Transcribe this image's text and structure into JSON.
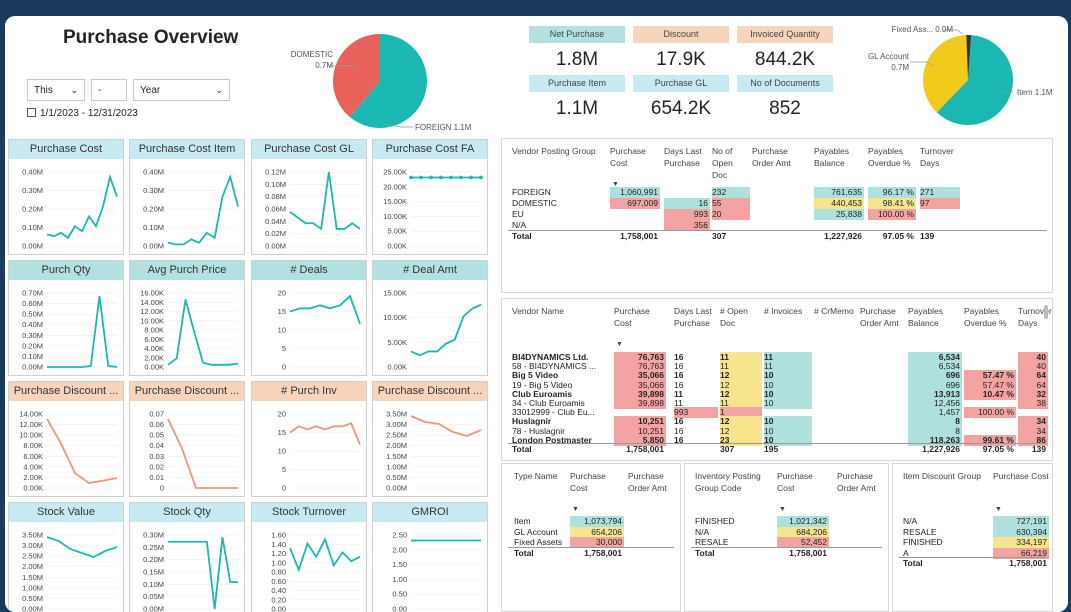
{
  "title": "Purchase Overview",
  "filters": {
    "period": "This",
    "count": "-",
    "unit": "Year",
    "date_range": "1/1/2023 - 12/31/2023"
  },
  "colors": {
    "teal": "#1ab8b0",
    "red": "#e8615a",
    "blue_hdr": "#c7e9f1",
    "orange_hdr": "#f9d4bd",
    "teal_hdr": "#b3e1e1",
    "salmon": "#e59a7b",
    "yellow": "#f2ca1c",
    "green_bar": "#aee0dd",
    "pink_bar": "#f4a3a3",
    "yellow_bar": "#f6e58d"
  },
  "pie1": {
    "domestic_label": "DOMESTIC",
    "domestic_value": "0.7M",
    "foreign_label": "FOREIGN 1.1M",
    "domestic": 0.7,
    "foreign": 1.1
  },
  "pie2": {
    "fixed_label": "Fixed Ass... 0.0M",
    "gl_label": "GL Account",
    "gl_value": "0.7M",
    "item_label": "Item 1.1M",
    "fixed": 0.03,
    "gl": 0.654,
    "item": 1.074
  },
  "kpis": [
    {
      "label": "Net Purchase",
      "value": "1.8M",
      "color": "teal_hdr"
    },
    {
      "label": "Discount",
      "value": "17.9K",
      "color": "orange_hdr"
    },
    {
      "label": "Invoiced Quantity",
      "value": "844.2K",
      "color": "orange_hdr"
    },
    {
      "label": "Purchase Item",
      "value": "1.1M",
      "color": "blue_hdr"
    },
    {
      "label": "Purchase GL",
      "value": "654.2K",
      "color": "blue_hdr"
    },
    {
      "label": "No of Documents",
      "value": "852",
      "color": "blue_hdr"
    }
  ],
  "chart_data": [
    {
      "type": "line",
      "title": "Purchase Cost",
      "color": "#1ab8b0",
      "yticks": [
        "0.40M",
        "0.30M",
        "0.20M",
        "0.10M",
        "0.00M"
      ],
      "ylim": [
        0,
        0.45
      ],
      "values": [
        0.07,
        0.06,
        0.08,
        0.05,
        0.12,
        0.09,
        0.18,
        0.12,
        0.24,
        0.42,
        0.3
      ]
    },
    {
      "type": "line",
      "title": "Purchase Cost Item",
      "color": "#1ab8b0",
      "yticks": [
        "0.40M",
        "0.30M",
        "0.20M",
        "0.10M",
        "0.00M"
      ],
      "ylim": [
        0,
        0.45
      ],
      "values": [
        0.02,
        0.01,
        0.01,
        0.04,
        0.02,
        0.08,
        0.05,
        0.3,
        0.42,
        0.24
      ]
    },
    {
      "type": "line",
      "title": "Purchase Cost GL",
      "color": "#1ab8b0",
      "yticks": [
        "0.12M",
        "0.10M",
        "0.08M",
        "0.06M",
        "0.04M",
        "0.02M",
        "0.00M"
      ],
      "ylim": [
        0,
        0.13
      ],
      "values": [
        0.06,
        0.05,
        0.04,
        0.04,
        0.03,
        0.13,
        0.03,
        0.03,
        0.04,
        0.03
      ]
    },
    {
      "type": "line",
      "title": "Purchase Cost FA",
      "color": "#1ab8b0",
      "yticks": [
        "25.00K",
        "20.00K",
        "15.00K",
        "10.00K",
        "5.00K",
        "0.00K"
      ],
      "ylim": [
        0,
        27
      ],
      "values": [
        25,
        25,
        25,
        25,
        25,
        25,
        25,
        25
      ],
      "marker": true
    },
    {
      "type": "line",
      "title": "Purch Qty",
      "color": "#1ab8b0",
      "yticks": [
        "0.70M",
        "0.60M",
        "0.50M",
        "0.40M",
        "0.30M",
        "0.20M",
        "0.10M",
        "0.00M"
      ],
      "ylim": [
        0,
        0.75
      ],
      "values": [
        0.0,
        0.0,
        0.0,
        0.0,
        0.0,
        0.01,
        0.72,
        0.01,
        0.0
      ]
    },
    {
      "type": "line",
      "title": "Avg Purch Price",
      "color": "#1ab8b0",
      "yticks": [
        "16.00K",
        "14.00K",
        "12.00K",
        "10.00K",
        "8.00K",
        "6.00K",
        "4.00K",
        "2.00K",
        "0.00K"
      ],
      "ylim": [
        0,
        17
      ],
      "values": [
        0.5,
        2,
        15.5,
        8,
        1,
        0.5,
        0.5,
        0.5,
        0.8
      ]
    },
    {
      "type": "line",
      "title": "# Deals",
      "color": "#1ab8b0",
      "yticks": [
        "20",
        "15",
        "10",
        "5",
        "0"
      ],
      "ylim": [
        0,
        24
      ],
      "values": [
        18,
        19,
        19,
        20,
        19,
        20,
        23,
        14
      ]
    },
    {
      "type": "line",
      "title": "# Deal Amt",
      "color": "#1ab8b0",
      "yticks": [
        "15.00K",
        "10.00K",
        "5.00K",
        "0.00K"
      ],
      "ylim": [
        0,
        19
      ],
      "values": [
        4,
        3,
        4,
        4,
        6,
        7,
        13,
        15,
        16
      ]
    },
    {
      "type": "line",
      "title": "Purchase Discount ...",
      "color": "#e59a7b",
      "yticks": [
        "14.00K",
        "12.00K",
        "10.00K",
        "8.00K",
        "6.00K",
        "4.00K",
        "2.00K",
        "0.00K"
      ],
      "ylim": [
        0,
        15
      ],
      "values": [
        14,
        9,
        3,
        1,
        1.5,
        2
      ]
    },
    {
      "type": "line",
      "title": "Purchase Discount ...",
      "color": "#e59a7b",
      "yticks": [
        "0.07",
        "0.06",
        "0.05",
        "0.04",
        "0.03",
        "0.02",
        "0.01",
        "0"
      ],
      "ylim": [
        0,
        0.075
      ],
      "values": [
        0.07,
        0.04,
        0.0,
        0.0,
        0.0,
        0.0
      ]
    },
    {
      "type": "line",
      "title": "# Purch Inv",
      "color": "#e59a7b",
      "yticks": [
        "20",
        "15",
        "10",
        "5",
        "0"
      ],
      "ylim": [
        0,
        24
      ],
      "values": [
        18,
        20,
        19,
        20,
        19,
        20,
        20,
        21,
        14
      ]
    },
    {
      "type": "line",
      "title": "Purchase Discount ...",
      "color": "#e59a7b",
      "yticks": [
        "3.50M",
        "3.00M",
        "2.50M",
        "2.00M",
        "1.50M",
        "1.00M",
        "0.50M",
        "0.00M"
      ],
      "ylim": [
        0,
        3.7
      ],
      "values": [
        3.6,
        3.3,
        3.2,
        2.8,
        2.6,
        2.9
      ]
    },
    {
      "type": "line",
      "title": "Stock Value",
      "color": "#1ab8b0",
      "yticks": [
        "3.50M",
        "3.00M",
        "2.50M",
        "2.00M",
        "1.50M",
        "1.00M",
        "0.50M",
        "0.00M"
      ],
      "ylim": [
        0,
        3.7
      ],
      "values": [
        3.6,
        3.4,
        3.0,
        2.8,
        2.6,
        2.9,
        3.1
      ]
    },
    {
      "type": "line",
      "title": "Stock Qty",
      "color": "#1ab8b0",
      "yticks": [
        "0.30M",
        "0.25M",
        "0.20M",
        "0.15M",
        "0.10M",
        "0.05M",
        "0.00M"
      ],
      "ylim": [
        0,
        0.33
      ],
      "values": [
        0.3,
        0.3,
        0.3,
        0.3,
        0.3,
        0.3,
        0.0,
        0.32,
        0.12,
        0.12
      ]
    },
    {
      "type": "line",
      "title": "Stock Turnover",
      "color": "#1ab8b0",
      "yticks": [
        "1.60",
        "1.40",
        "1.20",
        "1.00",
        "0.80",
        "0.60",
        "0.40",
        "0.20",
        "0.00"
      ],
      "ylim": [
        0,
        1.7
      ],
      "values": [
        1.4,
        0.9,
        1.5,
        1.2,
        1.6,
        1.0,
        1.3,
        1.1,
        1.2
      ]
    },
    {
      "type": "line",
      "title": "GMROI",
      "color": "#1ab8b0",
      "yticks": [
        "2.50",
        "2.00",
        "1.50",
        "1.00",
        "0.50",
        "0.00"
      ],
      "ylim": [
        0,
        2.7
      ],
      "values": [
        2.5,
        2.5,
        2.5,
        2.5,
        2.5,
        2.5,
        2.5
      ]
    }
  ],
  "vpg": {
    "headers": [
      "Vendor Posting Group",
      "Purchase Cost",
      "Days Last Purchase",
      "No of Open Doc",
      "Purchase Order Amt",
      "Payables Balance",
      "Payables Overdue %",
      "Turnover Days"
    ],
    "rows": [
      {
        "name": "FOREIGN",
        "cost": "1,060,991",
        "days": "",
        "open": "232",
        "order": "",
        "bal": "761,635",
        "ovd": "96.17 %",
        "turn": "271"
      },
      {
        "name": "DOMESTIC",
        "cost": "697,009",
        "days": "16",
        "open": "55",
        "order": "",
        "bal": "440,453",
        "ovd": "98.41 %",
        "turn": "97"
      },
      {
        "name": "EU",
        "cost": "",
        "days": "993",
        "open": "20",
        "order": "",
        "bal": "25,838",
        "ovd": "100.00 %",
        "turn": ""
      },
      {
        "name": "N/A",
        "cost": "",
        "days": "356",
        "open": "",
        "order": "",
        "bal": "",
        "ovd": "",
        "turn": ""
      }
    ],
    "total": {
      "name": "Total",
      "cost": "1,758,001",
      "days": "",
      "open": "307",
      "order": "",
      "bal": "1,227,926",
      "ovd": "97.05 %",
      "turn": "139"
    }
  },
  "vendors": {
    "headers": [
      "Vendor Name",
      "Purchase Cost",
      "Days Last Purchase",
      "# Open Doc",
      "# Invoices",
      "# CrMemo",
      "Purchase Order Amt",
      "Payables Balance",
      "Payables Overdue %",
      "Turnover Days"
    ],
    "rows": [
      {
        "name": "BI4DYNAMICS Ltd.",
        "bold": true,
        "cost": "76,763",
        "days": "16",
        "open": "11",
        "inv": "11",
        "bal": "6,534",
        "ovd": "",
        "turn": "40"
      },
      {
        "name": "58 - BI4DYNAMICS ...",
        "bold": false,
        "cost": "76,763",
        "days": "16",
        "open": "11",
        "inv": "11",
        "bal": "6,534",
        "ovd": "",
        "turn": "40"
      },
      {
        "name": "Big 5 Video",
        "bold": true,
        "cost": "35,066",
        "days": "16",
        "open": "12",
        "inv": "10",
        "bal": "696",
        "ovd": "57.47 %",
        "turn": "64"
      },
      {
        "name": "19 - Big 5 Video",
        "bold": false,
        "cost": "35,066",
        "days": "16",
        "open": "12",
        "inv": "10",
        "bal": "696",
        "ovd": "57.47 %",
        "turn": "64"
      },
      {
        "name": "Club Euroamis",
        "bold": true,
        "cost": "39,898",
        "days": "11",
        "open": "12",
        "inv": "10",
        "bal": "13,913",
        "ovd": "10.47 %",
        "turn": "32"
      },
      {
        "name": "34 - Club Euroamis",
        "bold": false,
        "cost": "39,898",
        "days": "11",
        "open": "11",
        "inv": "10",
        "bal": "12,456",
        "ovd": "",
        "turn": "38"
      },
      {
        "name": "33012999 - Club Eu...",
        "bold": false,
        "cost": "",
        "days": "993",
        "open": "1",
        "inv": "",
        "bal": "1,457",
        "ovd": "100.00 %",
        "turn": ""
      },
      {
        "name": "Huslagnir",
        "bold": true,
        "cost": "10,251",
        "days": "16",
        "open": "12",
        "inv": "10",
        "bal": "8",
        "ovd": "",
        "turn": "34"
      },
      {
        "name": "78 - Huslagnir",
        "bold": false,
        "cost": "10,251",
        "days": "16",
        "open": "12",
        "inv": "10",
        "bal": "8",
        "ovd": "",
        "turn": "34"
      },
      {
        "name": "London Postmaster",
        "bold": true,
        "cost": "5,850",
        "days": "16",
        "open": "23",
        "inv": "10",
        "bal": "118,263",
        "ovd": "99.61 %",
        "turn": "86"
      }
    ],
    "total": {
      "name": "Total",
      "cost": "1,758,001",
      "days": "",
      "open": "307",
      "inv": "195",
      "bal": "1,227,926",
      "ovd": "97.05 %",
      "turn": "139"
    }
  },
  "types": {
    "headers": [
      "Type Name",
      "Purchase Cost",
      "Purchase Order Amt"
    ],
    "rows": [
      {
        "name": "Item",
        "cost": "1,073,794"
      },
      {
        "name": "GL Account",
        "cost": "654,206"
      },
      {
        "name": "Fixed Assets",
        "cost": "30,000"
      }
    ],
    "total": {
      "name": "Total",
      "cost": "1,758,001"
    }
  },
  "inv_posting": {
    "headers": [
      "Inventory Posting Group Code",
      "Purchase Cost",
      "Purchase Order Amt"
    ],
    "rows": [
      {
        "name": "FINISHED",
        "cost": "1,021,342"
      },
      {
        "name": "N/A",
        "cost": "684,206"
      },
      {
        "name": "RESALE",
        "cost": "52,452"
      }
    ],
    "total": {
      "name": "Total",
      "cost": "1,758,001"
    }
  },
  "item_discount": {
    "headers": [
      "Item Discount Group",
      "Purchase Cost"
    ],
    "rows": [
      {
        "name": "N/A",
        "cost": "727,191"
      },
      {
        "name": "RESALE",
        "cost": "630,394"
      },
      {
        "name": "FINISHED",
        "cost": "334,197"
      },
      {
        "name": "A",
        "cost": "66,219"
      }
    ],
    "total": {
      "name": "Total",
      "cost": "1,758,001"
    }
  }
}
